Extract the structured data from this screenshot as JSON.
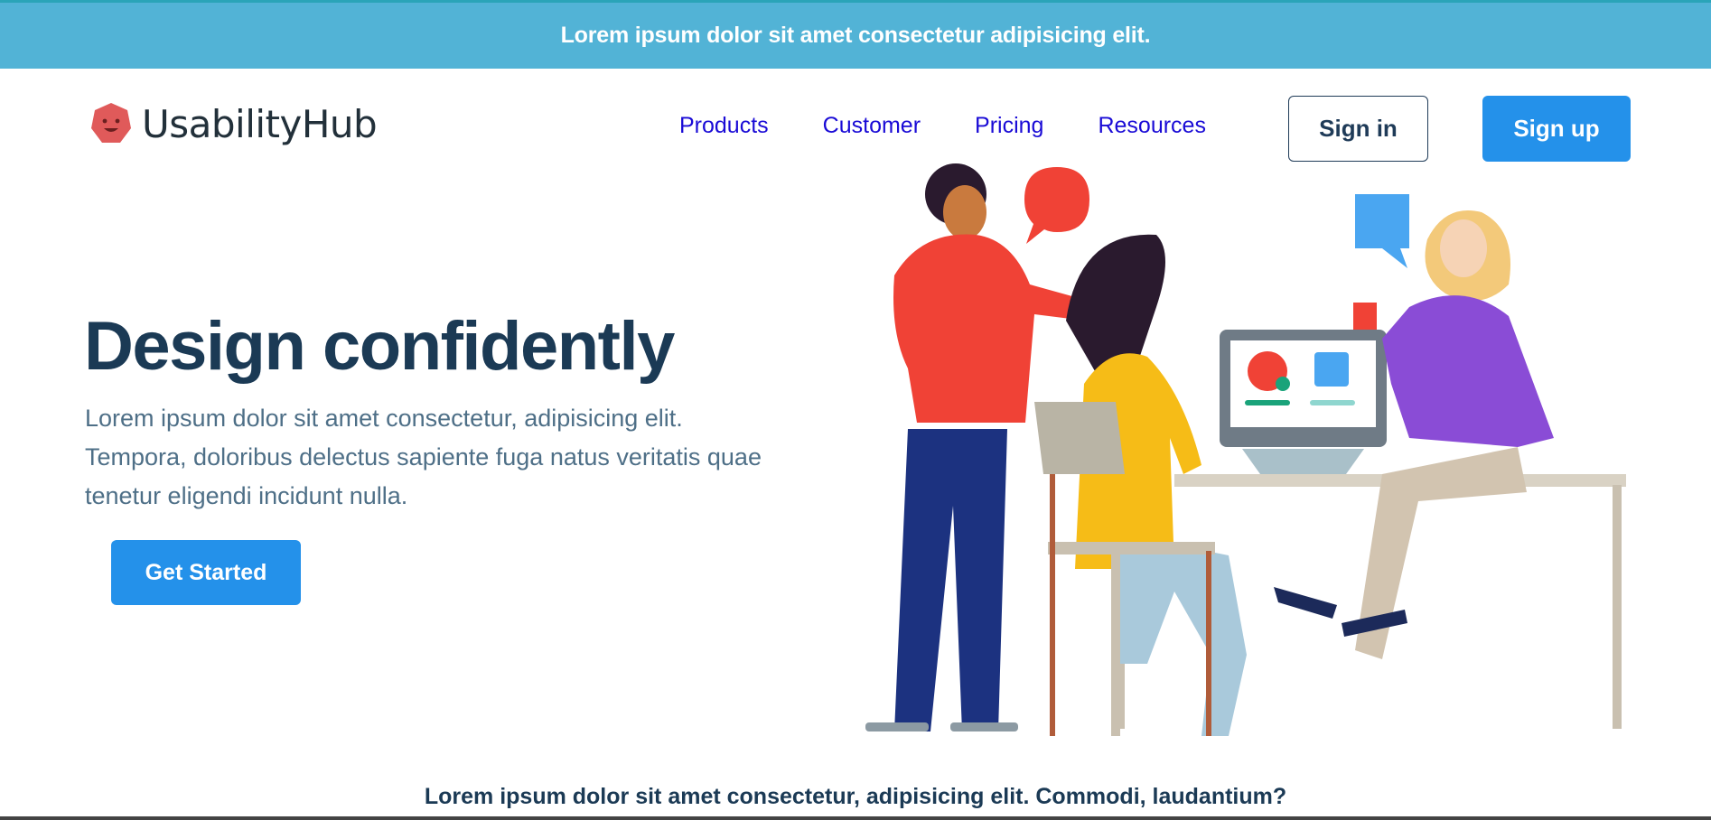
{
  "announcement": {
    "text": "Lorem ipsum dolor sit amet consectetur adipisicing elit."
  },
  "brand": {
    "name": "UsabilityHub",
    "color": "#e05a5a"
  },
  "nav": {
    "items": [
      {
        "label": "Products"
      },
      {
        "label": "Customer"
      },
      {
        "label": "Pricing"
      },
      {
        "label": "Resources"
      }
    ],
    "signin_label": "Sign in",
    "signup_label": "Sign up"
  },
  "hero": {
    "title": "Design confidently",
    "description": "Lorem ipsum dolor sit amet consectetur, adipisicing elit. Tempora, doloribus delectus sapiente fuga natus veritatis quae tenetur eligendi incidunt nulla.",
    "cta_label": "Get Started"
  },
  "footer": {
    "text": "Lorem ipsum dolor sit amet consectetur, adipisicing elit. Commodi, laudantium?"
  },
  "colors": {
    "announcement_bg": "#52b3d6",
    "primary_button": "#2491ea",
    "heading": "#1b3a55",
    "nav_link": "#1a0bd6"
  }
}
